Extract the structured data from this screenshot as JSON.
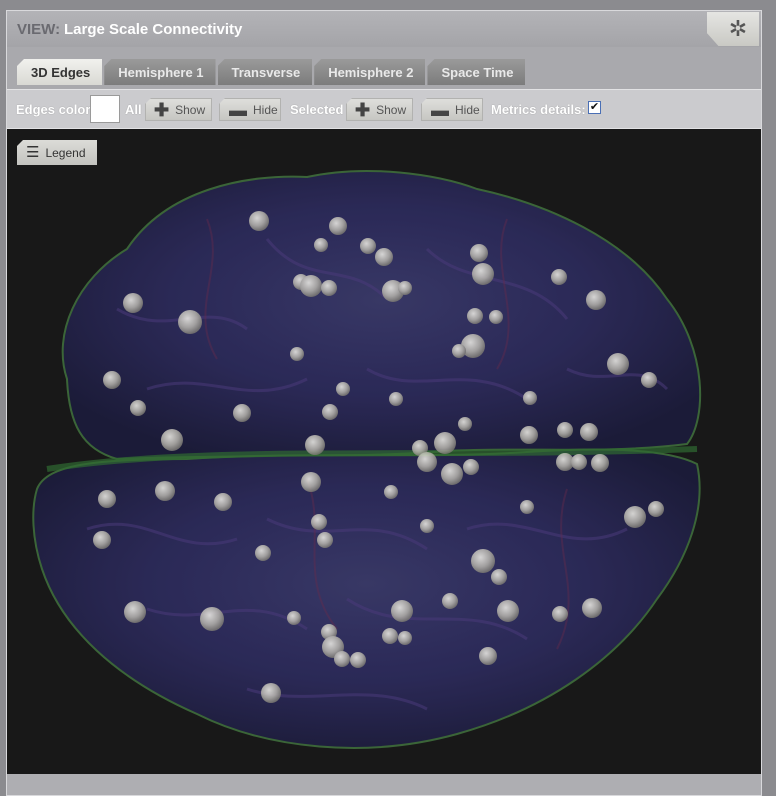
{
  "header": {
    "view_label": "VIEW:",
    "title": "Large Scale Connectivity",
    "settings_icon": "gear-icon"
  },
  "tabs": [
    {
      "label": "3D Edges",
      "active": true
    },
    {
      "label": "Hemisphere 1",
      "active": false
    },
    {
      "label": "Transverse",
      "active": false
    },
    {
      "label": "Hemisphere 2",
      "active": false
    },
    {
      "label": "Space Time",
      "active": false
    }
  ],
  "toolbar": {
    "edges_color_label": "Edges color",
    "edges_color_value": "#ffffff",
    "all_label": "All",
    "all_show_label": "Show",
    "all_hide_label": "Hide",
    "selected_label": "Selected",
    "selected_show_label": "Show",
    "selected_hide_label": "Hide",
    "metrics_label": "Metrics details:",
    "metrics_checked": true
  },
  "canvas": {
    "legend_label": "Legend",
    "legend_icon": "menu-icon",
    "background": "#181818"
  }
}
